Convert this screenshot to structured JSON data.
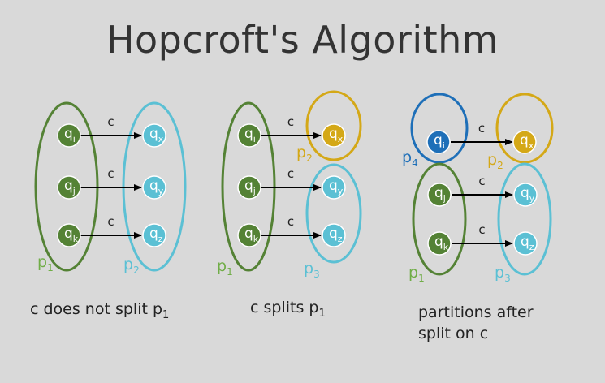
{
  "title": "Hopcroft's Algorithm",
  "colors": {
    "background": "#d9d9d9",
    "green": "#548235",
    "light_green_text": "#70ad47",
    "cyan": "#5bc0d4",
    "gold": "#d4a817",
    "blue": "#1e6fb8"
  },
  "diagram1": {
    "states_left": [
      {
        "base": "q",
        "sub": "i"
      },
      {
        "base": "q",
        "sub": "j"
      },
      {
        "base": "q",
        "sub": "k"
      }
    ],
    "states_right": [
      {
        "base": "q",
        "sub": "x"
      },
      {
        "base": "q",
        "sub": "y"
      },
      {
        "base": "q",
        "sub": "z"
      }
    ],
    "edge_labels": [
      "c",
      "c",
      "c"
    ],
    "partition_left": {
      "base": "p",
      "sub": "1"
    },
    "partition_right": {
      "base": "p",
      "sub": "2"
    },
    "caption": "c does not split p",
    "caption_sub": "1"
  },
  "diagram2": {
    "states_left": [
      {
        "base": "q",
        "sub": "i"
      },
      {
        "base": "q",
        "sub": "j"
      },
      {
        "base": "q",
        "sub": "k"
      }
    ],
    "states_right": [
      {
        "base": "q",
        "sub": "x"
      },
      {
        "base": "q",
        "sub": "y"
      },
      {
        "base": "q",
        "sub": "z"
      }
    ],
    "edge_labels": [
      "c",
      "c",
      "c"
    ],
    "partition_left": {
      "base": "p",
      "sub": "1"
    },
    "partition_top": {
      "base": "p",
      "sub": "2"
    },
    "partition_bottom": {
      "base": "p",
      "sub": "3"
    },
    "caption": "c splits p",
    "caption_sub": "1"
  },
  "diagram3": {
    "state_top_left": {
      "base": "q",
      "sub": "i"
    },
    "states_bottom_left": [
      {
        "base": "q",
        "sub": "j"
      },
      {
        "base": "q",
        "sub": "k"
      }
    ],
    "state_top_right": {
      "base": "q",
      "sub": "x"
    },
    "states_bottom_right": [
      {
        "base": "q",
        "sub": "y"
      },
      {
        "base": "q",
        "sub": "z"
      }
    ],
    "edge_labels": [
      "c",
      "c",
      "c"
    ],
    "partition_top_left": {
      "base": "p",
      "sub": "4"
    },
    "partition_top_right": {
      "base": "p",
      "sub": "2"
    },
    "partition_bottom_left": {
      "base": "p",
      "sub": "1"
    },
    "partition_bottom_right": {
      "base": "p",
      "sub": "3"
    },
    "caption_line1": "partitions after",
    "caption_line2": "split on c"
  }
}
